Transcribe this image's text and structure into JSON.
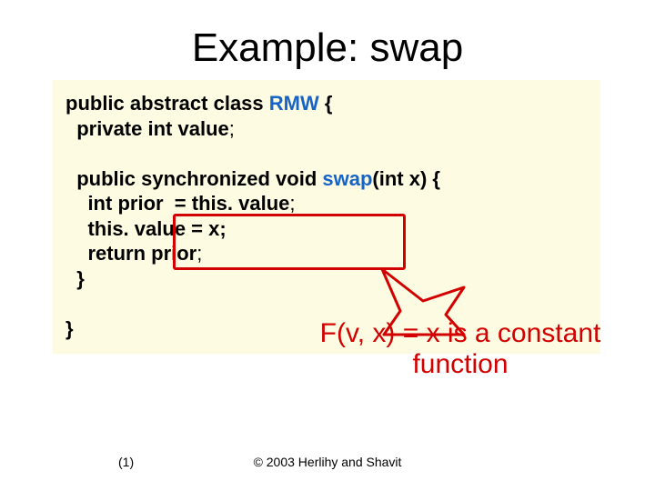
{
  "title": "Example: swap",
  "code": {
    "l1a": "public abstract class ",
    "l1b": "RMW",
    "l1c": " {",
    "l2a": "  private int ",
    "l2b": "value",
    "l2c": ";",
    "blank1": " ",
    "l3a": "  public synchronized void ",
    "l3b": "swap",
    "l3c": "(int x) {",
    "l4a": "    int ",
    "l4b": "prior",
    "l4c": "  = this. ",
    "l4d": "value",
    "l4e": ";",
    "l5a": "    this. ",
    "l5b": "value",
    "l5c": " = x;",
    "l6a": "    return ",
    "l6b": "prior",
    "l6c": ";",
    "l7": "  }",
    "blank2": " ",
    "l8": "}"
  },
  "callout": "F(v, x) = x is a constant function",
  "footer": {
    "page": "(1)",
    "copyright": "© 2003 Herlihy and Shavit"
  }
}
